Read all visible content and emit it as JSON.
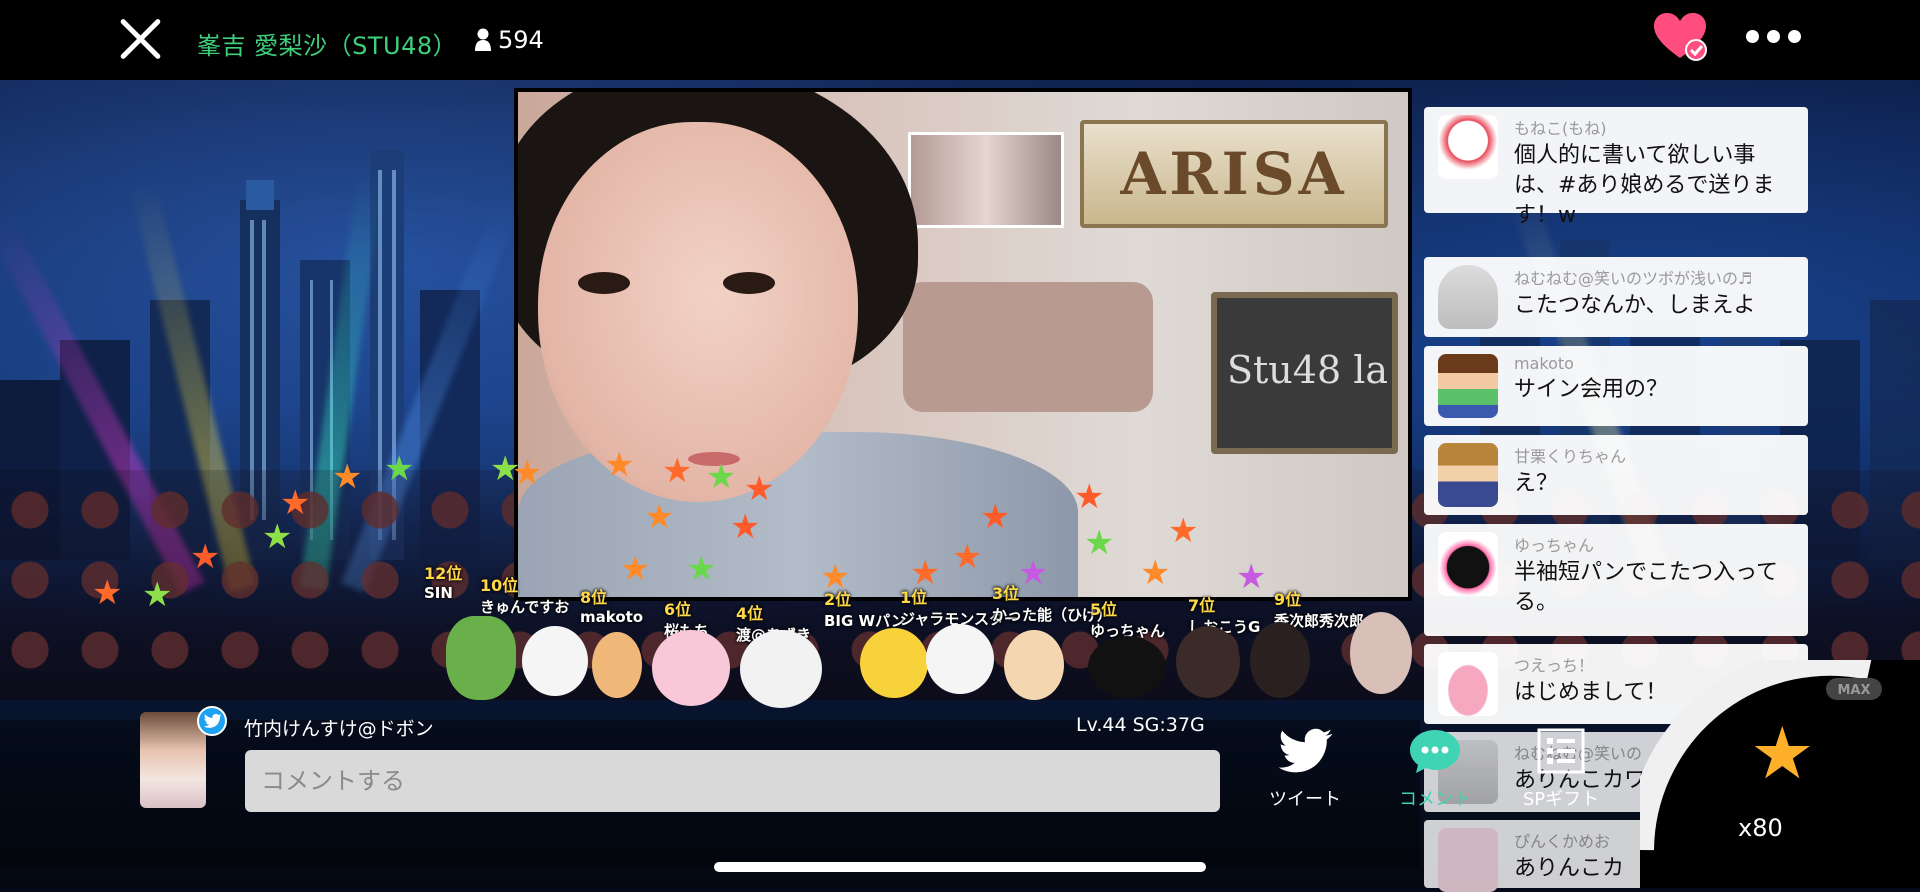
{
  "header": {
    "stream_title": "峯吉 愛梨沙（STU48）",
    "viewer_count": "594"
  },
  "video": {
    "room_sign": "ARISA",
    "board_text": "Stu48 la"
  },
  "ranking": [
    {
      "rank": "12位",
      "name": "SIN"
    },
    {
      "rank": "10位",
      "name": "きゅんですお"
    },
    {
      "rank": "8位",
      "name": "makoto"
    },
    {
      "rank": "6位",
      "name": "桜もち"
    },
    {
      "rank": "4位",
      "name": "渡@あずき"
    },
    {
      "rank": "2位",
      "name": "BIG Wパン"
    },
    {
      "rank": "1位",
      "name": "ジャラモンスター"
    },
    {
      "rank": "3位",
      "name": "かった能（ひげ）"
    },
    {
      "rank": "5位",
      "name": "ゆっちゃん"
    },
    {
      "rank": "7位",
      "name": "しおこうG"
    },
    {
      "rank": "9位",
      "name": "香次郎秀次郎"
    }
  ],
  "comments": [
    {
      "user": "もねこ(もね)",
      "text": "個人的に書いて欲しい事は、#あり娘めるで送ります！w"
    },
    {
      "user": "ねむねむ@笑いのツボが浅いの♬",
      "text": "こたつなんか、しまえよ"
    },
    {
      "user": "makoto",
      "text": "サイン会用の？"
    },
    {
      "user": "甘栗くりちゃん",
      "text": "え？"
    },
    {
      "user": "ゆっちゃん",
      "text": "半袖短パンでこたつ入ってる。"
    },
    {
      "user": "つえっち！",
      "text": "はじめまして！"
    },
    {
      "user": "ねむねむ@笑いの",
      "text": "ありんこカワ"
    },
    {
      "user": "ぴんくかめお",
      "text": "ありんこカ"
    }
  ],
  "footer": {
    "user_name": "竹内けんすけ@ドボン",
    "level": "Lv.44  SG:37G",
    "comment_placeholder": "コメントする",
    "actions": {
      "tweet": "ツイート",
      "comment": "コメント",
      "sp_gift": "SPギフト"
    },
    "gift_count": "x80",
    "max_label": "MAX"
  },
  "colors": {
    "title_green": "#3fd07a",
    "heart_pink": "#ff4d7d",
    "comment_active": "#3fd4b4",
    "twitter_blue": "#1da1f2",
    "star_orange": "#ff8a2a"
  },
  "icons": [
    "close-icon",
    "person-icon",
    "heart-check-icon",
    "more-icon",
    "twitter-icon",
    "comment-bubble-icon",
    "gift-list-icon",
    "star-gift-icon"
  ]
}
